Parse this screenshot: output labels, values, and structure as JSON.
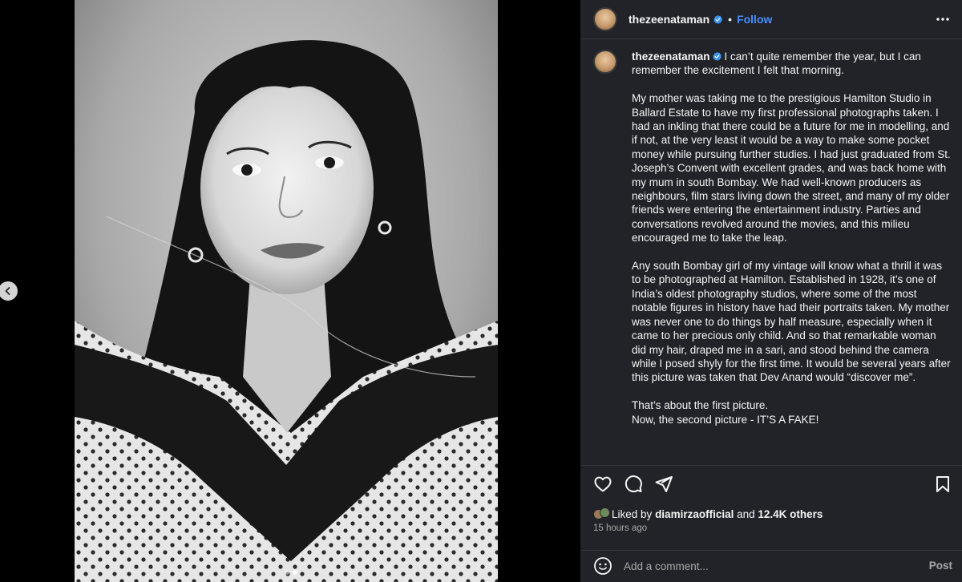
{
  "post": {
    "author": {
      "username": "thezeenataman",
      "verified": true,
      "avatar_icon": "profile-avatar"
    },
    "follow_label": "Follow",
    "separator": "•",
    "caption": {
      "username": "thezeenataman",
      "paragraphs": [
        "I can’t quite remember the year, but I can remember the excitement I felt that morning.",
        "My mother was taking me to the prestigious Hamilton Studio in Ballard Estate to have my first professional photographs taken. I had an inkling that there could be a future for me in modelling, and if not, at the very least it would be a way to make some pocket money while pursuing further studies. I had just graduated from St. Joseph’s Convent with excellent grades, and was back home with my mum in south Bombay. We had well-known producers as neighbours, film stars living down the street, and many of my older friends were entering the entertainment industry. Parties and conversations revolved around the movies, and this milieu encouraged me to take the leap.",
        "Any south Bombay girl of my vintage will know what a thrill it was to be photographed at Hamilton. Established in 1928, it’s one of India’s oldest photography studios, where some of the most notable figures in history have had their portraits taken. My mother was never one to do things by half measure, especially when it came to her precious only child. And so that remarkable woman did my hair, draped me in a sari, and stood behind the camera while I posed shyly for the first time. It would be several years after this picture was taken that Dev Anand would “discover me”.",
        "That’s about the first picture.",
        "Now, the second picture - IT’S A FAKE!"
      ]
    },
    "likes": {
      "prefix": "Liked by",
      "user": "diamirzaofficial",
      "connector": "and",
      "others": "12.4K others"
    },
    "timestamp": "15 hours ago",
    "comment": {
      "placeholder": "Add a comment...",
      "post_label": "Post"
    },
    "carousel": {
      "current_index": 1,
      "total": 2
    }
  },
  "colors": {
    "panel_bg": "#212328",
    "follow_blue": "#4a8ef8",
    "verified_blue": "#3b95f1",
    "muted_text": "#a8a8a8"
  }
}
